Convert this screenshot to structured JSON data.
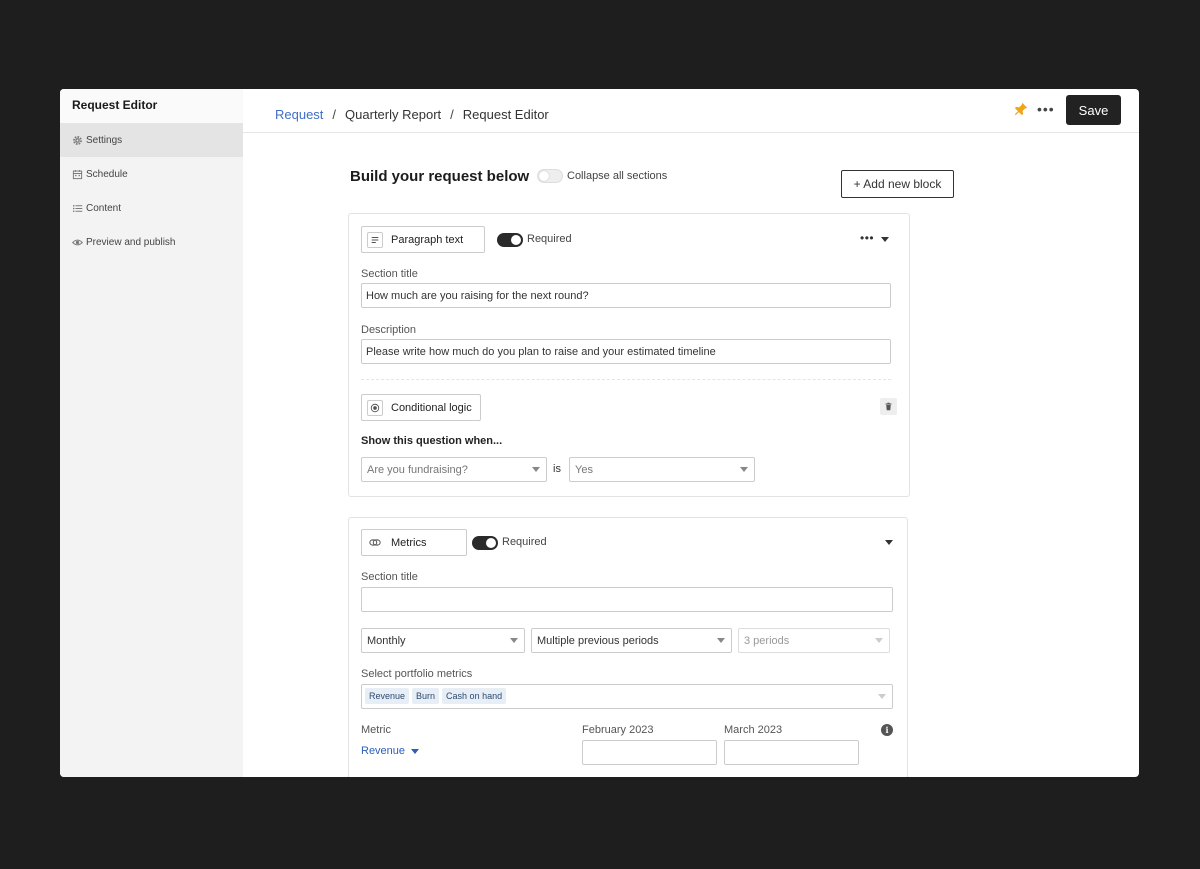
{
  "sidebar": {
    "title": "Request Editor",
    "items": [
      {
        "label": "Settings",
        "icon": "gear-icon",
        "active": true
      },
      {
        "label": "Schedule",
        "icon": "calendar-icon",
        "active": false
      },
      {
        "label": "Content",
        "icon": "list-icon",
        "active": false
      },
      {
        "label": "Preview and publish",
        "icon": "eye-icon",
        "active": false
      }
    ]
  },
  "header": {
    "breadcrumb": [
      "Request",
      "Quarterly Report",
      "Request Editor"
    ],
    "save_label": "Save",
    "more_label": "•••",
    "pin_color": "#f2a417"
  },
  "main": {
    "title": "Build your request below",
    "collapse_label": "Collapse all sections",
    "collapse_on": false,
    "add_block_label": "+ Add new block"
  },
  "block1": {
    "type_label": "Paragraph text",
    "required_label": "Required",
    "required_on": true,
    "section_title_label": "Section title",
    "section_title_value": "How much are you raising for the next round?",
    "description_label": "Description",
    "description_value": "Please write how much do you plan to raise and your estimated timeline",
    "conditional_label": "Conditional logic",
    "show_question_label": "Show this question when...",
    "condition_question": "Are you fundraising?",
    "is_label": "is",
    "condition_answer": "Yes",
    "more_label": "•••"
  },
  "block2": {
    "type_label": "Metrics",
    "required_label": "Required",
    "required_on": true,
    "section_title_label": "Section title",
    "section_title_value": "",
    "frequency": "Monthly",
    "period_type": "Multiple previous periods",
    "period_count": "3 periods",
    "portfolio_metrics_label": "Select portfolio metrics",
    "portfolio_metrics": [
      "Revenue",
      "Burn",
      "Cash on hand"
    ],
    "metric_col_label": "Metric",
    "metric_value": "Revenue",
    "period_cols": [
      "February 2023",
      "March 2023"
    ],
    "info_label": "i"
  }
}
